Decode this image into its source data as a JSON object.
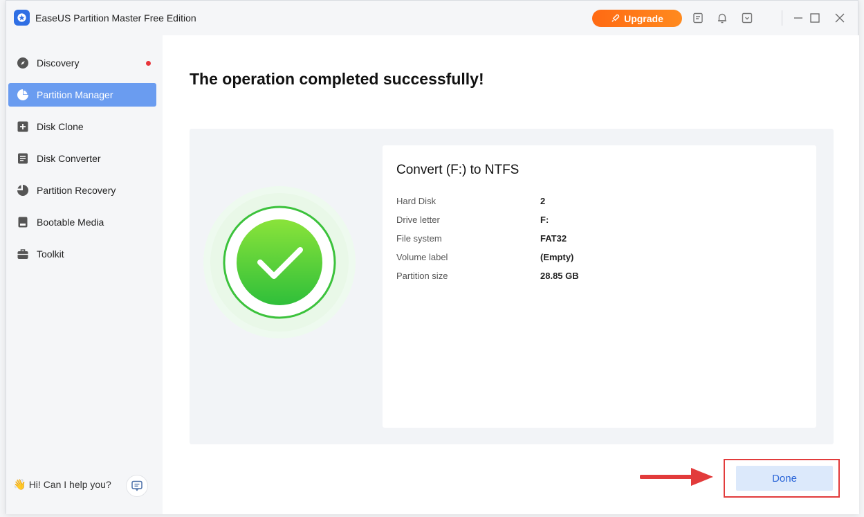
{
  "titlebar": {
    "app_title": "EaseUS Partition Master Free Edition",
    "upgrade_label": "Upgrade"
  },
  "sidebar": {
    "items": [
      {
        "label": "Discovery",
        "icon": "compass-icon"
      },
      {
        "label": "Partition Manager",
        "icon": "pie-chart-icon"
      },
      {
        "label": "Disk Clone",
        "icon": "clone-plus-icon"
      },
      {
        "label": "Disk Converter",
        "icon": "converter-icon"
      },
      {
        "label": "Partition Recovery",
        "icon": "recovery-icon"
      },
      {
        "label": "Bootable Media",
        "icon": "bootable-media-icon"
      },
      {
        "label": "Toolkit",
        "icon": "toolkit-icon"
      }
    ],
    "active_index": 1,
    "help_text": "Hi! Can I help you?"
  },
  "main": {
    "headline": "The operation completed successfully!",
    "operation_title": "Convert (F:) to NTFS",
    "details": [
      {
        "key": "Hard Disk",
        "value": "2"
      },
      {
        "key": "Drive letter",
        "value": "F:"
      },
      {
        "key": "File system",
        "value": "FAT32"
      },
      {
        "key": "Volume label",
        "value": "(Empty)"
      },
      {
        "key": "Partition size",
        "value": "28.85 GB"
      }
    ],
    "done_label": "Done"
  },
  "colors": {
    "accent": "#6a9cf0",
    "upgrade": "#ff7a18",
    "success": "#3cc23c",
    "highlight": "#e23b3b"
  }
}
